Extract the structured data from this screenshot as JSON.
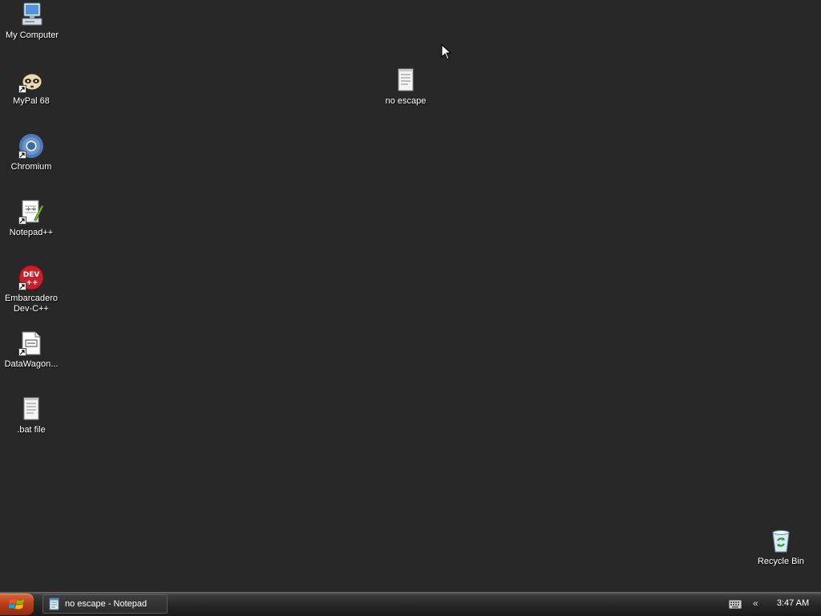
{
  "desktop": {
    "icons": {
      "my_computer": {
        "label": "My Computer"
      },
      "mypal": {
        "label": "MyPal 68"
      },
      "chromium": {
        "label": "Chromium"
      },
      "notepadpp": {
        "label": "Notepad++"
      },
      "devcpp": {
        "label": "Embarcadero\nDev-C++"
      },
      "datawagon": {
        "label": "DataWagon..."
      },
      "bat_file": {
        "label": ".bat file"
      },
      "no_escape": {
        "label": "no escape"
      },
      "recycle_bin": {
        "label": "Recycle Bin"
      }
    }
  },
  "taskbar": {
    "tasks": [
      {
        "label": "no escape - Notepad",
        "icon": "notepad-icon"
      }
    ],
    "tray": {
      "expand_label": "«",
      "clock": "3:47 AM"
    }
  },
  "colors": {
    "desktop_background": "#282828",
    "start_button": "#b8401c"
  }
}
